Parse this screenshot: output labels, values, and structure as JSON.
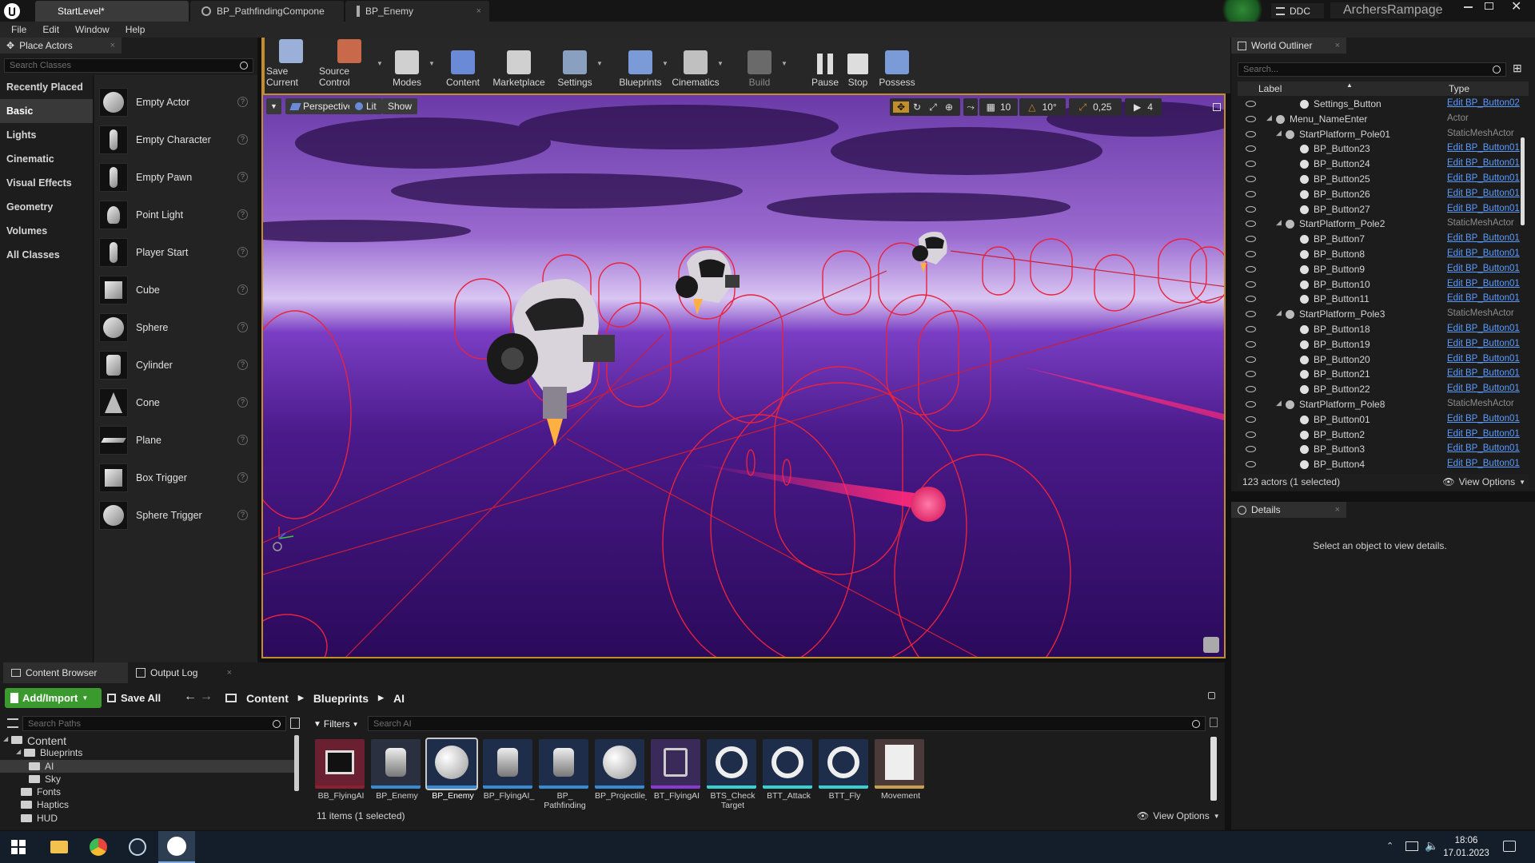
{
  "titlebar": {
    "tabs": [
      "StartLevel*",
      "BP_PathfindingCompone",
      "BP_Enemy"
    ],
    "ddc_label": "DDC",
    "project_name": "ArchersRampage"
  },
  "menu": [
    "File",
    "Edit",
    "Window",
    "Help"
  ],
  "place_actors": {
    "tab_label": "Place Actors",
    "search_placeholder": "Search Classes",
    "categories": [
      "Recently Placed",
      "Basic",
      "Lights",
      "Cinematic",
      "Visual Effects",
      "Geometry",
      "Volumes",
      "All Classes"
    ],
    "selected_category": "Basic",
    "actors": [
      "Empty Actor",
      "Empty Character",
      "Empty Pawn",
      "Point Light",
      "Player Start",
      "Cube",
      "Sphere",
      "Cylinder",
      "Cone",
      "Plane",
      "Box Trigger",
      "Sphere Trigger"
    ]
  },
  "toolbar": {
    "buttons": [
      "Save Current",
      "Source Control",
      "Modes",
      "Content",
      "Marketplace",
      "Settings",
      "Blueprints",
      "Cinematics",
      "Build",
      "Pause",
      "Stop",
      "Possess"
    ]
  },
  "viewport": {
    "perspective_label": "Perspective",
    "lit_label": "Lit",
    "show_label": "Show",
    "grid_snap": "10",
    "rotation_snap": "10°",
    "scale_snap": "0,25",
    "camera_speed": "4"
  },
  "outliner": {
    "tab_label": "World Outliner",
    "search_placeholder": "Search...",
    "col_label": "Label",
    "col_type": "Type",
    "rows": [
      {
        "label": "Settings_Button",
        "type": "Edit BP_Button02",
        "link": true,
        "depth": 2
      },
      {
        "label": "Menu_NameEnter",
        "type": "Actor",
        "link": false,
        "depth": 1
      },
      {
        "label": "StartPlatform_Pole01",
        "type": "StaticMeshActor",
        "link": false,
        "depth": 1
      },
      {
        "label": "BP_Button23",
        "type": "Edit BP_Button01",
        "link": true,
        "depth": 2
      },
      {
        "label": "BP_Button24",
        "type": "Edit BP_Button01",
        "link": true,
        "depth": 2
      },
      {
        "label": "BP_Button25",
        "type": "Edit BP_Button01",
        "link": true,
        "depth": 2
      },
      {
        "label": "BP_Button26",
        "type": "Edit BP_Button01",
        "link": true,
        "depth": 2
      },
      {
        "label": "BP_Button27",
        "type": "Edit BP_Button01",
        "link": true,
        "depth": 2
      },
      {
        "label": "StartPlatform_Pole2",
        "type": "StaticMeshActor",
        "link": false,
        "depth": 1
      },
      {
        "label": "BP_Button7",
        "type": "Edit BP_Button01",
        "link": true,
        "depth": 2
      },
      {
        "label": "BP_Button8",
        "type": "Edit BP_Button01",
        "link": true,
        "depth": 2
      },
      {
        "label": "BP_Button9",
        "type": "Edit BP_Button01",
        "link": true,
        "depth": 2
      },
      {
        "label": "BP_Button10",
        "type": "Edit BP_Button01",
        "link": true,
        "depth": 2
      },
      {
        "label": "BP_Button11",
        "type": "Edit BP_Button01",
        "link": true,
        "depth": 2
      },
      {
        "label": "StartPlatform_Pole3",
        "type": "StaticMeshActor",
        "link": false,
        "depth": 1
      },
      {
        "label": "BP_Button18",
        "type": "Edit BP_Button01",
        "link": true,
        "depth": 2
      },
      {
        "label": "BP_Button19",
        "type": "Edit BP_Button01",
        "link": true,
        "depth": 2
      },
      {
        "label": "BP_Button20",
        "type": "Edit BP_Button01",
        "link": true,
        "depth": 2
      },
      {
        "label": "BP_Button21",
        "type": "Edit BP_Button01",
        "link": true,
        "depth": 2
      },
      {
        "label": "BP_Button22",
        "type": "Edit BP_Button01",
        "link": true,
        "depth": 2
      },
      {
        "label": "StartPlatform_Pole8",
        "type": "StaticMeshActor",
        "link": false,
        "depth": 1
      },
      {
        "label": "BP_Button01",
        "type": "Edit BP_Button01",
        "link": true,
        "depth": 2
      },
      {
        "label": "BP_Button2",
        "type": "Edit BP_Button01",
        "link": true,
        "depth": 2
      },
      {
        "label": "BP_Button3",
        "type": "Edit BP_Button01",
        "link": true,
        "depth": 2
      },
      {
        "label": "BP_Button4",
        "type": "Edit BP_Button01",
        "link": true,
        "depth": 2
      }
    ],
    "status": "123 actors (1 selected)",
    "view_options": "View Options"
  },
  "details": {
    "tab_label": "Details",
    "empty_text": "Select an object to view details."
  },
  "content_browser": {
    "tabs": [
      "Content Browser",
      "Output Log"
    ],
    "add_import": "Add/Import",
    "save_all": "Save All",
    "breadcrumb": [
      "Content",
      "Blueprints",
      "AI"
    ],
    "search_paths_placeholder": "Search Paths",
    "filters_label": "Filters",
    "search_assets_placeholder": "Search AI",
    "tree": [
      {
        "label": "Content",
        "depth": 0
      },
      {
        "label": "Blueprints",
        "depth": 1
      },
      {
        "label": "AI",
        "depth": 2
      },
      {
        "label": "Sky",
        "depth": 2
      },
      {
        "label": "Fonts",
        "depth": 1
      },
      {
        "label": "Haptics",
        "depth": 1
      },
      {
        "label": "HUD",
        "depth": 1
      }
    ],
    "assets": [
      "BB_FlyingAI",
      "BP_Enemy",
      "BP_Enemy",
      "BP_FlyingAI_",
      "BP_\nPathfinding",
      "BP_Projectile_",
      "BT_FlyingAI",
      "BTS_Check\nTarget",
      "BTT_Attack",
      "BTT_Fly",
      "Movement"
    ],
    "status": "11 items (1 selected)",
    "view_options": "View Options"
  },
  "taskbar": {
    "time": "18:06",
    "date": "17.01.2023"
  }
}
